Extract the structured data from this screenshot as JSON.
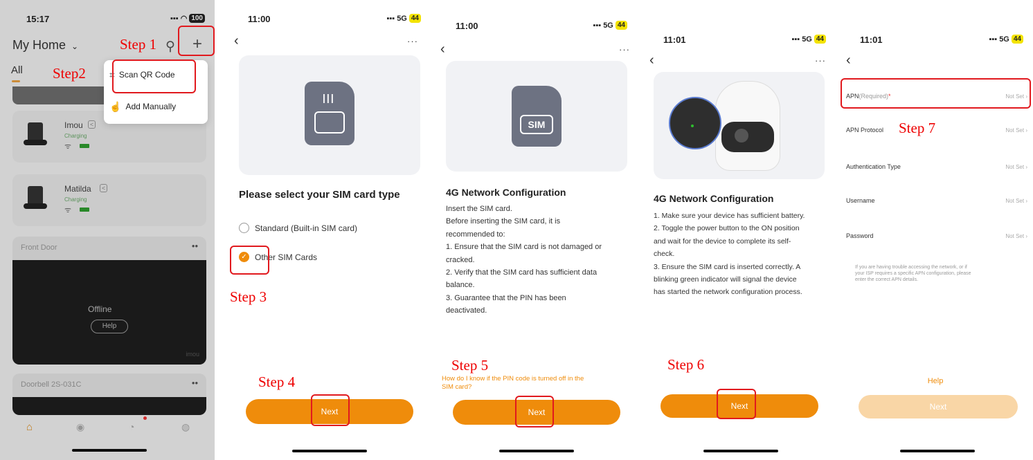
{
  "colors": {
    "accent": "#ef8c0b",
    "annotation": "#e1191e"
  },
  "p1": {
    "time": "15:17",
    "battery": "100",
    "title": "My Home",
    "tab_all": "All",
    "menu": {
      "scan": "Scan QR Code",
      "add": "Add Manually"
    },
    "devices": [
      {
        "name": "Imou",
        "status": "Charging"
      },
      {
        "name": "Matilda",
        "status": "Charging"
      }
    ],
    "front_door": {
      "name": "Front Door",
      "offline": "Offline",
      "help": "Help",
      "watermark": "imou"
    },
    "doorbell": {
      "name": "Doorbell 2S-031C"
    },
    "nav_icons": [
      "home-icon",
      "compass-icon",
      "message-icon",
      "bulb-icon"
    ]
  },
  "p2": {
    "time": "11:00",
    "network": "5G",
    "battery": "44",
    "heading": "Please select your SIM card type",
    "options": [
      "Standard (Built-in SIM card)",
      "Other SIM Cards"
    ],
    "next": "Next"
  },
  "p3": {
    "time": "11:00",
    "network": "5G",
    "battery": "44",
    "sim_label": "SIM",
    "heading": "4G Network Configuration",
    "lines": [
      "Insert the SIM card.",
      "Before inserting the SIM card, it is",
      "recommended to:",
      "1. Ensure that the SIM card is not damaged or",
      "cracked.",
      "2. Verify that the SIM card has sufficient data",
      "balance.",
      "3. Guarantee that the PIN has been",
      "deactivated."
    ],
    "link": [
      "How do I know if the PIN code is turned off in the",
      "SIM card?"
    ],
    "next": "Next"
  },
  "p4": {
    "time": "11:01",
    "network": "5G",
    "battery": "44",
    "heading": "4G Network Configuration",
    "lines": [
      "1. Make sure your device has sufficient battery.",
      "2. Toggle the power button to the ON position",
      "and wait for the device to complete its self-",
      "check.",
      "3. Ensure the SIM card is inserted correctly. A",
      "blinking green indicator will signal the device",
      "has started the network configuration process."
    ],
    "next": "Next"
  },
  "p5": {
    "time": "11:01",
    "network": "5G",
    "battery": "44",
    "apn_label": "APN",
    "apn_req": "(Required)",
    "apn_star": "*",
    "fields": [
      "APN Protocol",
      "Authentication Type",
      "Username",
      "Password"
    ],
    "not_set": "Not Set",
    "hint": [
      "If you are having trouble accessing the network, or if",
      "your ISP requires a specific APN configuration, please",
      "enter the correct APN details."
    ],
    "help": "Help",
    "next": "Next"
  },
  "annotations": {
    "s1": "Step 1",
    "s2": "Step2",
    "s3": "Step 3",
    "s4": "Step 4",
    "s5": "Step 5",
    "s6": "Step 6",
    "s7": "Step 7"
  }
}
